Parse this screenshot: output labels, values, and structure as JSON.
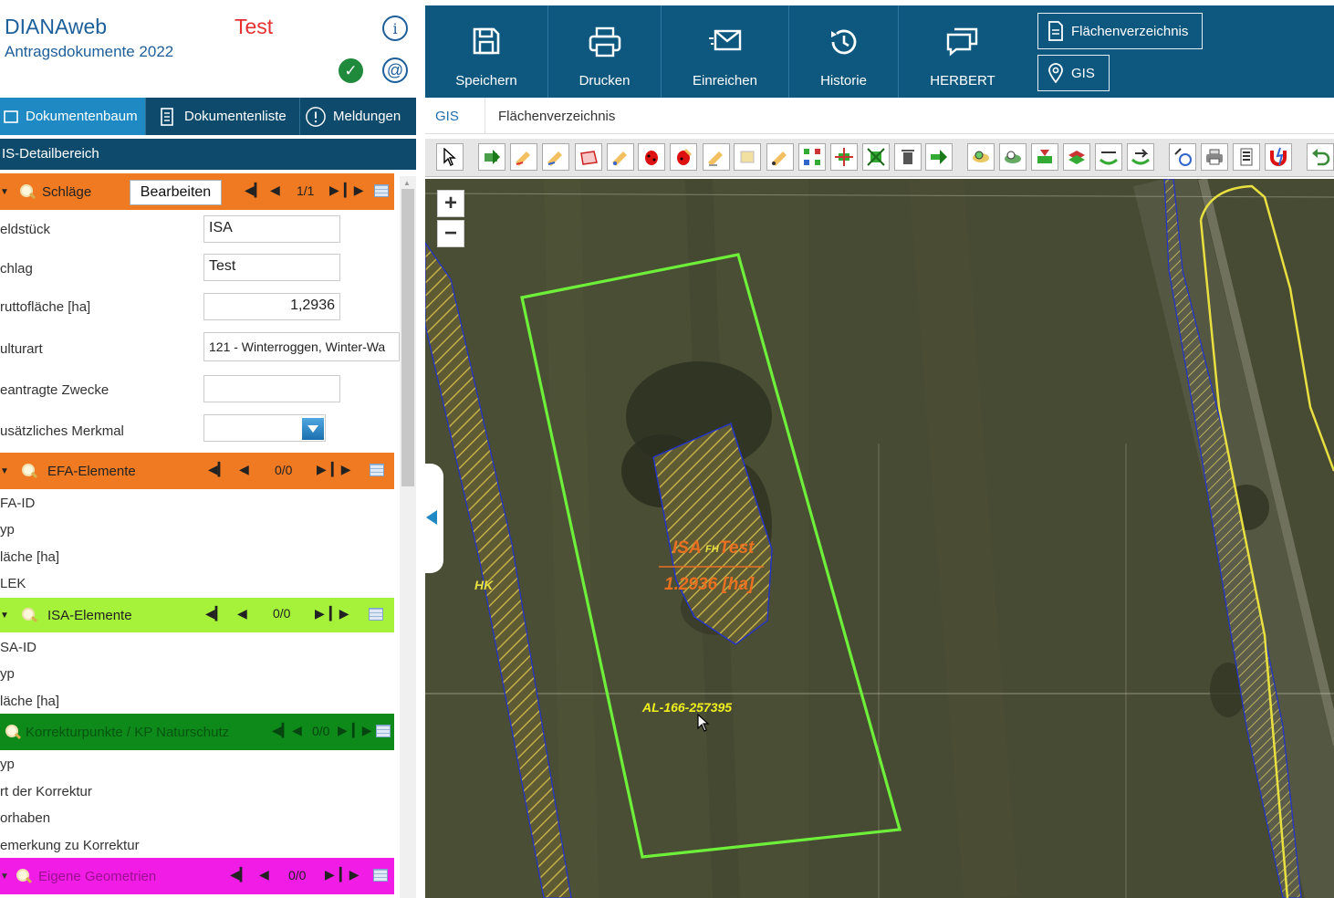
{
  "app": {
    "title": "DIANAweb",
    "subtitle": "Antragsdokumente 2022",
    "status": "Test",
    "colors": {
      "accent": "#1d5f9a",
      "status": "#e53030",
      "nav": "#0e4a6b",
      "active_tab": "#1e89c3"
    }
  },
  "tabs": [
    {
      "label": "Dokumentenbaum",
      "icon": "tree-icon"
    },
    {
      "label": "Dokumentenliste",
      "icon": "document-list-icon"
    },
    {
      "label": "Meldungen",
      "icon": "alert-icon"
    }
  ],
  "detail_header": "IS-Detailbereich",
  "sections": {
    "schlaege": {
      "title": "Schläge",
      "edit": "Bearbeiten",
      "pager": "1/1",
      "color": "#ef7a22"
    },
    "efa": {
      "title": "EFA-Elemente",
      "pager": "0/0",
      "color": "#ef7a22"
    },
    "isa": {
      "title": "ISA-Elemente",
      "pager": "0/0",
      "color": "#a6f23a"
    },
    "korrektur": {
      "title": "Korrekturpunkte / KP Naturschutz",
      "pager": "0/0",
      "color": "#0d8a1a"
    },
    "eigene": {
      "title": "Eigene Geometrien",
      "pager": "0/0",
      "color": "#f21ce7"
    }
  },
  "schlag_fields": [
    {
      "label": "eldstück",
      "value": "ISA"
    },
    {
      "label": "chlag",
      "value": "Test"
    },
    {
      "label": "ruttofläche [ha]",
      "value": "1,2936"
    },
    {
      "label": "ulturart",
      "value": "121 - Winterroggen, Winter-Wa"
    },
    {
      "label": "eantragte Zwecke",
      "value": ""
    },
    {
      "label": "usätzliches Merkmal",
      "value": ""
    }
  ],
  "efa_fields": [
    "FA-ID",
    "yp",
    "läche [ha]",
    "LEK"
  ],
  "isa_fields": [
    "SA-ID",
    "yp",
    "läche [ha]"
  ],
  "korrektur_fields": [
    "yp",
    "rt der Korrektur",
    "orhaben",
    "emerkung zu Korrektur"
  ],
  "toolbar": [
    {
      "label": "Speichern",
      "icon": "save-icon"
    },
    {
      "label": "Drucken",
      "icon": "print-icon"
    },
    {
      "label": "Einreichen",
      "icon": "submit-mail-icon"
    },
    {
      "label": "Historie",
      "icon": "history-icon"
    },
    {
      "label": "HERBERT",
      "icon": "chat-icon"
    }
  ],
  "toolbar_right": [
    {
      "label": "Flächenverzeichnis",
      "icon": "document-icon"
    },
    {
      "label": "GIS",
      "icon": "location-pin-icon"
    }
  ],
  "subtabs": [
    {
      "label": "GIS"
    },
    {
      "label": "Flächenverzeichnis"
    }
  ],
  "map": {
    "zoom_in": "+",
    "zoom_out": "−",
    "label_hk": "HK",
    "label_isa": "ISA",
    "label_fh": "FH",
    "label_test": "Test",
    "label_area": "1.2936 [ha]",
    "label_parcel": "AL-166-257395"
  }
}
